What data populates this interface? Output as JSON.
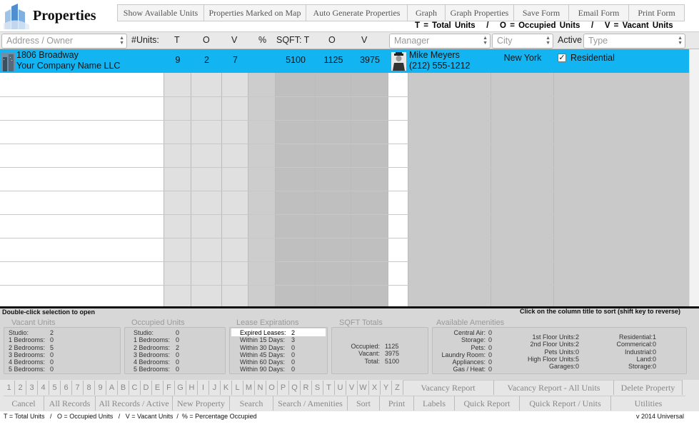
{
  "app": {
    "title": "Properties",
    "version": "v 2014 Universal"
  },
  "toolbar": [
    "Show Available Units",
    "Properties Marked on Map",
    "Auto Generate Properties",
    "Graph",
    "Graph Properties",
    "Save Form",
    "Email Form",
    "Print Form"
  ],
  "legend_top": "T = Total Units   /   O = Occupied Units   /   V = Vacant Units",
  "filters": {
    "address_placeholder": "Address / Owner",
    "manager_placeholder": "Manager",
    "city_placeholder": "City",
    "type_placeholder": "Type"
  },
  "columns": {
    "units": "#Units:",
    "t": "T",
    "o": "O",
    "v": "V",
    "pct": "%",
    "sqft": "SQFT: T",
    "sqft_o": "O",
    "sqft_v": "V",
    "active": "Active"
  },
  "rows": [
    {
      "address": "1806 Broadway",
      "owner": "Your Company Name LLC",
      "units_t": "9",
      "units_o": "2",
      "units_v": "7",
      "pct": "",
      "sqft_t": "5100",
      "sqft_o": "1125",
      "sqft_v": "3975",
      "manager": "Mike Meyers",
      "phone": "(212) 555-1212",
      "city": "New York",
      "active": true,
      "type": "Residential"
    }
  ],
  "hint_left": "Double-click selection to open",
  "hint_right": "Click on the column title to sort (shift key to reverse)",
  "summary": {
    "vacant": {
      "title": "Vacant Units",
      "items": [
        [
          "Studio:",
          "2"
        ],
        [
          "1 Bedrooms:",
          "0"
        ],
        [
          "2 Bedrooms:",
          "5"
        ],
        [
          "3 Bedrooms:",
          "0"
        ],
        [
          "4 Bedrooms:",
          "0"
        ],
        [
          "5 Bedrooms:",
          "0"
        ]
      ]
    },
    "occupied": {
      "title": "Occupied Units",
      "items": [
        [
          "Studio:",
          "0"
        ],
        [
          "1 Bedrooms:",
          "0"
        ],
        [
          "2 Bedrooms:",
          "2"
        ],
        [
          "3 Bedrooms:",
          "0"
        ],
        [
          "4 Bedrooms:",
          "0"
        ],
        [
          "5 Bedrooms:",
          "0"
        ]
      ]
    },
    "lease": {
      "title": "Lease Expirations",
      "items": [
        [
          "Expired Leases:",
          "2"
        ],
        [
          "Within 15 Days:",
          "3"
        ],
        [
          "Within 30 Days:",
          "0"
        ],
        [
          "Within 45 Days:",
          "0"
        ],
        [
          "Within 60 Days:",
          "0"
        ],
        [
          "Within 90 Days:",
          "0"
        ]
      ]
    },
    "sqft": {
      "title": "SQFT Totals",
      "items": [
        [
          "Occupied:",
          "1125"
        ],
        [
          "Vacant:",
          "3975"
        ],
        [
          "Total:",
          "5100"
        ]
      ]
    },
    "amenities": {
      "title": "Available Amenities",
      "items": [
        [
          "Central Air:",
          "0"
        ],
        [
          "Storage:",
          "0"
        ],
        [
          "Pets:",
          "0"
        ],
        [
          "Laundry Room:",
          "0"
        ],
        [
          "Appliances:",
          "0"
        ],
        [
          "Gas / Heat:",
          "0"
        ]
      ],
      "floors": [
        [
          "1st Floor Units:",
          "2"
        ],
        [
          "2nd Floor Units:",
          "2"
        ],
        [
          "Pets Units:",
          "0"
        ],
        [
          "High Floor Units:",
          "5"
        ],
        [
          "Garages:",
          "0"
        ]
      ],
      "types": [
        [
          "Residential:",
          "1"
        ],
        [
          "Commerical:",
          "0"
        ],
        [
          "Industrial:",
          "0"
        ],
        [
          "Land:",
          "0"
        ],
        [
          "Storage:",
          "0"
        ]
      ]
    }
  },
  "letters": [
    "1",
    "2",
    "3",
    "4",
    "5",
    "6",
    "7",
    "8",
    "9",
    "A",
    "B",
    "C",
    "D",
    "E",
    "F",
    "G",
    "H",
    "I",
    "J",
    "K",
    "L",
    "M",
    "N",
    "O",
    "P",
    "Q",
    "R",
    "S",
    "T",
    "U",
    "V",
    "W",
    "X",
    "Y",
    "Z"
  ],
  "buttons_row1": [
    "Vacancy Report",
    "Vacancy Report - All Units",
    "Delete Property"
  ],
  "buttons_row2": [
    "Cancel",
    "All Records",
    "All Records / Active",
    "New Property",
    "Search",
    "Search / Amenities",
    "Sort",
    "Print",
    "Labels",
    "Quick Report",
    "Quick Report / Units",
    "Utilities"
  ],
  "footer_legend": "T = Total Units   /   O = Occupied Units   /   V = Vacant Units  /  % = Percentage Occupied",
  "colors": {
    "selection": "#12b5f1",
    "panel": "#d7d7d7"
  }
}
